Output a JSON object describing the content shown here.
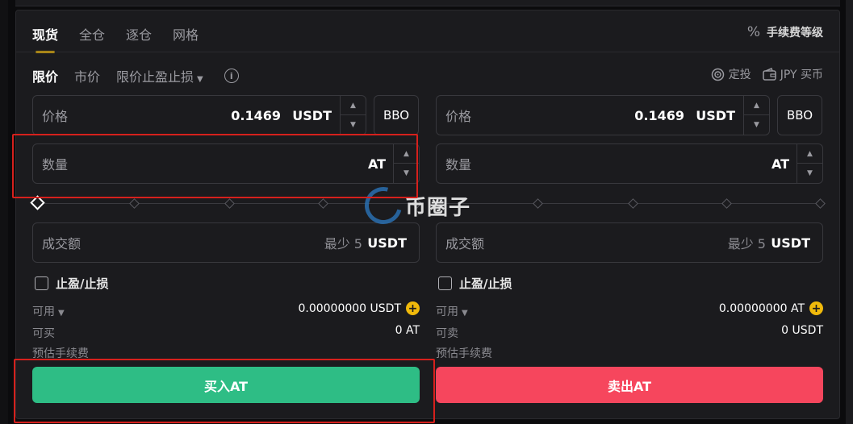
{
  "tabs": [
    {
      "label": "现货",
      "active": true
    },
    {
      "label": "全仓",
      "active": false
    },
    {
      "label": "逐仓",
      "active": false
    },
    {
      "label": "网格",
      "active": false
    }
  ],
  "fee_level": {
    "label": "手续费等级",
    "icon": "percent-icon"
  },
  "order_types": [
    {
      "label": "限价",
      "active": true
    },
    {
      "label": "市价",
      "active": false
    },
    {
      "label": "限价止盈止损",
      "active": false,
      "dropdown": true
    }
  ],
  "actions": {
    "auto_invest": "定投",
    "buy_with_fiat": "JPY 买币"
  },
  "buy": {
    "price_label": "价格",
    "price_value": "0.1469",
    "price_unit": "USDT",
    "bbo": "BBO",
    "qty_label": "数量",
    "qty_unit": "AT",
    "total_label": "成交额",
    "total_min": "最少 5",
    "total_unit": "USDT",
    "tpsl": "止盈/止损",
    "available_label": "可用",
    "available_value": "0.00000000 USDT",
    "max_label": "可买",
    "max_value": "0 AT",
    "fee_label": "预估手续费",
    "button": "买入AT"
  },
  "sell": {
    "price_label": "价格",
    "price_value": "0.1469",
    "price_unit": "USDT",
    "bbo": "BBO",
    "qty_label": "数量",
    "qty_unit": "AT",
    "total_label": "成交额",
    "total_min": "最少 5",
    "total_unit": "USDT",
    "tpsl": "止盈/止损",
    "available_label": "可用",
    "available_value": "0.00000000 AT",
    "max_label": "可卖",
    "max_value": "0 USDT",
    "fee_label": "预估手续费",
    "button": "卖出AT"
  },
  "slider_level": 0,
  "watermark": "币圈子",
  "colors": {
    "buy": "#2ebd85",
    "sell": "#f6465d",
    "accent": "#f0b90b",
    "highlight": "#d6201c"
  }
}
